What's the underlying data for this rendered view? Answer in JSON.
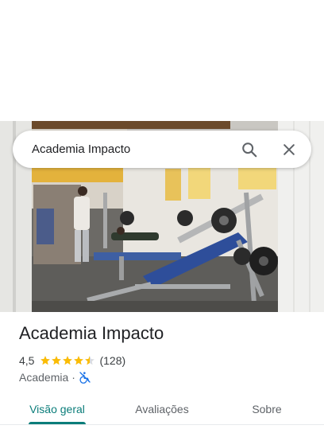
{
  "search": {
    "query": "Academia Impacto"
  },
  "place": {
    "name": "Academia Impacto",
    "rating": "4,5",
    "rating_value": 4.5,
    "review_count": "(128)",
    "category": "Academia",
    "separator": "·"
  },
  "tabs": [
    {
      "label": "Visão geral",
      "active": true
    },
    {
      "label": "Avaliações",
      "active": false
    },
    {
      "label": "Sobre",
      "active": false
    }
  ],
  "colors": {
    "accent": "#0b7d7a",
    "star": "#fbbc04",
    "wheelchair": "#1a73e8"
  },
  "icons": {
    "search": "search-icon",
    "close": "close-icon",
    "wheelchair": "wheelchair-not-accessible-icon"
  }
}
